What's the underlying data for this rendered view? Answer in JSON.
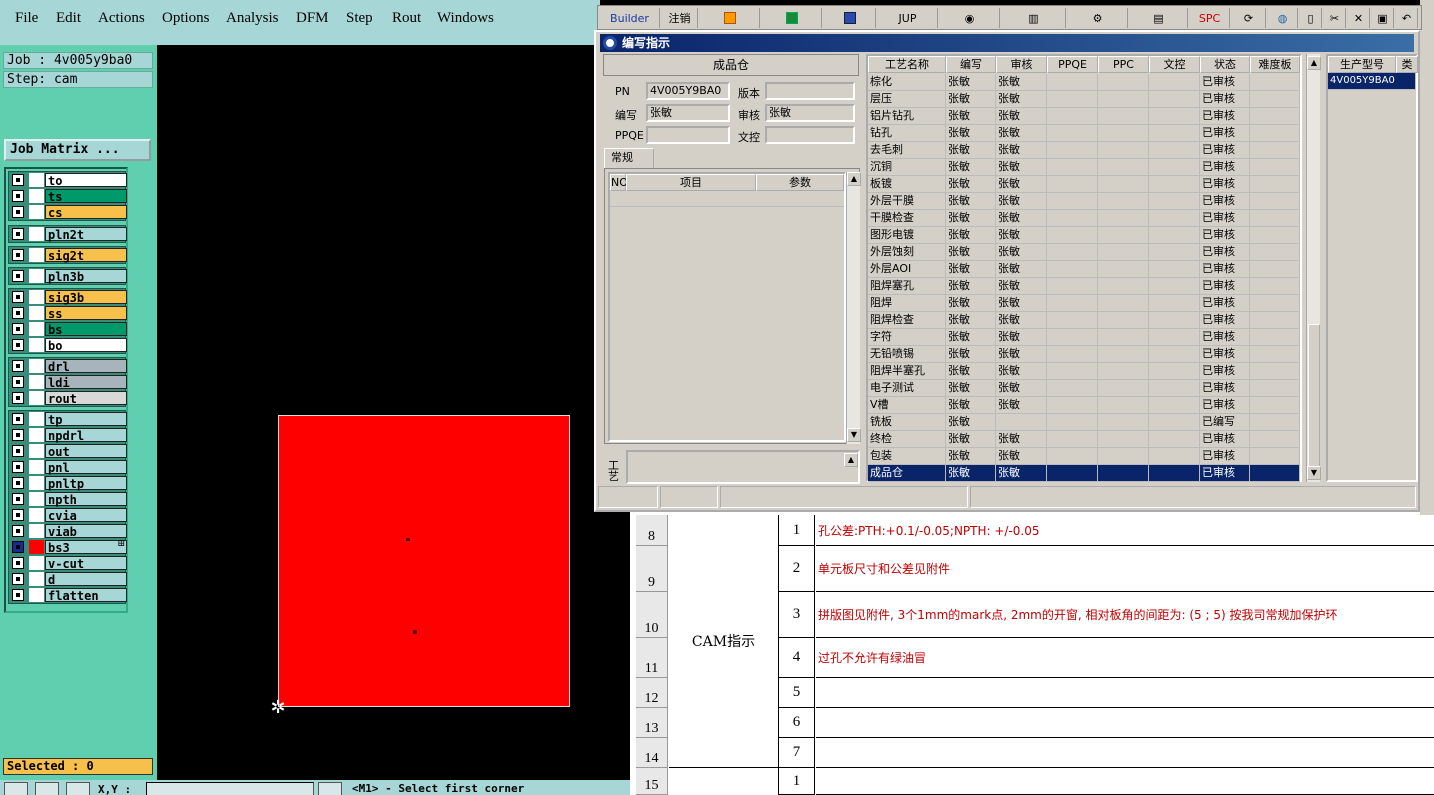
{
  "menu": [
    "File",
    "Edit",
    "Actions",
    "Options",
    "Analysis",
    "DFM",
    "Step",
    "Rout",
    "Windows"
  ],
  "job": "Job : 4v005y9ba0",
  "step": "Step: cam",
  "job_matrix": "Job Matrix ...",
  "selected": "Selected : 0",
  "xy_label": "X,Y :",
  "prompt": "<M1> - Select first corner",
  "layers": [
    {
      "name": "to",
      "color": "#ffffff"
    },
    {
      "name": "ts",
      "color": "#009a6a"
    },
    {
      "name": "cs",
      "color": "#f7c04b"
    },
    {
      "name": "pln2t",
      "color": "#a6d6d6"
    },
    {
      "name": "sig2t",
      "color": "#f7c04b"
    },
    {
      "name": "pln3b",
      "color": "#a6d6d6"
    },
    {
      "name": "sig3b",
      "color": "#f7c04b"
    },
    {
      "name": "ss",
      "color": "#f7c04b"
    },
    {
      "name": "bs",
      "color": "#009a6a"
    },
    {
      "name": "bo",
      "color": "#ffffff"
    },
    {
      "name": "drl",
      "color": "#a8b4bc"
    },
    {
      "name": "ldi",
      "color": "#a8b4bc"
    },
    {
      "name": "rout",
      "color": "#d8d8d8"
    },
    {
      "name": "tp",
      "color": "#a6d6d6"
    },
    {
      "name": "npdrl",
      "color": "#a6d6d6"
    },
    {
      "name": "out",
      "color": "#a6d6d6"
    },
    {
      "name": "pnl",
      "color": "#a6d6d6"
    },
    {
      "name": "pnltp",
      "color": "#a6d6d6"
    },
    {
      "name": "npth",
      "color": "#a6d6d6"
    },
    {
      "name": "cvia",
      "color": "#a6d6d6"
    },
    {
      "name": "viab",
      "color": "#a6d6d6"
    },
    {
      "name": "bs3",
      "color": "#a6d6d6"
    },
    {
      "name": "v-cut",
      "color": "#a6d6d6"
    },
    {
      "name": "d",
      "color": "#a6d6d6"
    },
    {
      "name": "flatten",
      "color": "#a6d6d6"
    }
  ],
  "erp_toolbar": [
    "Builder",
    "注销",
    "JUP",
    "SPC"
  ],
  "dialog": {
    "title": "编写指示",
    "section": "成品仓",
    "pn_label": "PN",
    "pn_value": "4V005Y9BA0",
    "version_label": "版本",
    "version_value": "",
    "writer_label": "编写",
    "writer_value": "张敏",
    "reviewer_label": "审核",
    "reviewer_value": "张敏",
    "ppqe_label": "PPQE",
    "ppqe_value": "",
    "doc_label": "文控",
    "doc_value": "",
    "tab": "常规",
    "param_headers": [
      "NO",
      "项目",
      "参数"
    ],
    "gongyi_label": "工艺",
    "process_headers": [
      "工艺名称",
      "编写",
      "审核",
      "PPQE",
      "PPC",
      "文控",
      "状态",
      "难度板"
    ],
    "processes": [
      [
        "棕化",
        "张敏",
        "张敏",
        "",
        "",
        "",
        "已审核",
        ""
      ],
      [
        "层压",
        "张敏",
        "张敏",
        "",
        "",
        "",
        "已审核",
        ""
      ],
      [
        "铝片钻孔",
        "张敏",
        "张敏",
        "",
        "",
        "",
        "已审核",
        ""
      ],
      [
        "钻孔",
        "张敏",
        "张敏",
        "",
        "",
        "",
        "已审核",
        ""
      ],
      [
        "去毛刺",
        "张敏",
        "张敏",
        "",
        "",
        "",
        "已审核",
        ""
      ],
      [
        "沉铜",
        "张敏",
        "张敏",
        "",
        "",
        "",
        "已审核",
        ""
      ],
      [
        "板镀",
        "张敏",
        "张敏",
        "",
        "",
        "",
        "已审核",
        ""
      ],
      [
        "外层干膜",
        "张敏",
        "张敏",
        "",
        "",
        "",
        "已审核",
        ""
      ],
      [
        "干膜检查",
        "张敏",
        "张敏",
        "",
        "",
        "",
        "已审核",
        ""
      ],
      [
        "图形电镀",
        "张敏",
        "张敏",
        "",
        "",
        "",
        "已审核",
        ""
      ],
      [
        "外层蚀刻",
        "张敏",
        "张敏",
        "",
        "",
        "",
        "已审核",
        ""
      ],
      [
        "外层AOI",
        "张敏",
        "张敏",
        "",
        "",
        "",
        "已审核",
        ""
      ],
      [
        "阻焊塞孔",
        "张敏",
        "张敏",
        "",
        "",
        "",
        "已审核",
        ""
      ],
      [
        "阻焊",
        "张敏",
        "张敏",
        "",
        "",
        "",
        "已审核",
        ""
      ],
      [
        "阻焊检查",
        "张敏",
        "张敏",
        "",
        "",
        "",
        "已审核",
        ""
      ],
      [
        "字符",
        "张敏",
        "张敏",
        "",
        "",
        "",
        "已审核",
        ""
      ],
      [
        "无铅喷锡",
        "张敏",
        "张敏",
        "",
        "",
        "",
        "已审核",
        ""
      ],
      [
        "阻焊半塞孔",
        "张敏",
        "张敏",
        "",
        "",
        "",
        "已审核",
        ""
      ],
      [
        "电子测试",
        "张敏",
        "张敏",
        "",
        "",
        "",
        "已审核",
        ""
      ],
      [
        "V槽",
        "张敏",
        "张敏",
        "",
        "",
        "",
        "已审核",
        ""
      ],
      [
        "铣板",
        "张敏",
        "",
        "",
        "",
        "",
        "已编写",
        ""
      ],
      [
        "终检",
        "张敏",
        "张敏",
        "",
        "",
        "",
        "已审核",
        ""
      ],
      [
        "包装",
        "张敏",
        "张敏",
        "",
        "",
        "",
        "已审核",
        ""
      ],
      [
        "成品仓",
        "张敏",
        "张敏",
        "",
        "",
        "",
        "已审核",
        ""
      ]
    ],
    "model_headers": [
      "生产型号",
      "类别"
    ],
    "models": [
      "4V005Y9BA0"
    ]
  },
  "sheet": {
    "cam_label": "CAM指示",
    "row_numbers": [
      "8",
      "9",
      "10",
      "11",
      "12",
      "13",
      "14",
      "15"
    ],
    "items": [
      {
        "no": "1",
        "text": "孔公差:PTH:+0.1/-0.05;NPTH: +/-0.05"
      },
      {
        "no": "2",
        "text": "单元板尺寸和公差见附件"
      },
      {
        "no": "3",
        "text": "拼版图见附件, 3个1mm的mark点, 2mm的开窗, 相对板角的间距为: (5 ; 5) 按我司常规加保护环"
      },
      {
        "no": "4",
        "text": "过孔不允许有绿油冒"
      },
      {
        "no": "5",
        "text": ""
      },
      {
        "no": "6",
        "text": ""
      },
      {
        "no": "7",
        "text": ""
      },
      {
        "no": "1",
        "text": ""
      }
    ]
  }
}
